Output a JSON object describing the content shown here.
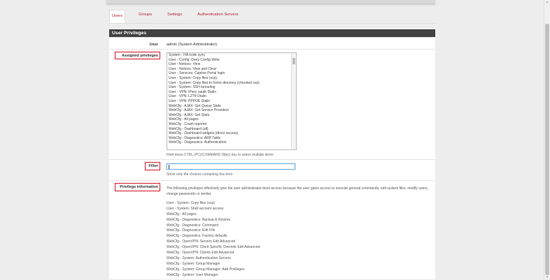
{
  "tabs": [
    {
      "label": "Users",
      "active": true
    },
    {
      "label": "Groups",
      "active": false
    },
    {
      "label": "Settings",
      "active": false
    },
    {
      "label": "Authentication Servers",
      "active": false
    }
  ],
  "panel_title": "User Privileges",
  "user": {
    "label": "User",
    "value": "admin (System Administrator)"
  },
  "assigned": {
    "label": "Assigned privileges",
    "options": [
      "System - HA node sync",
      "User - Config: Deny Config Write",
      "User - Notices: View",
      "User - Notices: View and Clear",
      "User - Services: Captive Portal login",
      "User - System: Copy files (scp).",
      "User - System: Copy files to home directory (chrooted scp)",
      "User - System: SSH tunneling",
      "User - VPN: IPsec xauth Dialin",
      "User - VPN: L2TP Dialin",
      "User - VPN: PPPOE Dialin",
      "WebCfg - AJAX: Get Queue Stats",
      "WebCfg - AJAX: Get Service Providers",
      "WebCfg - AJAX: Get Stats",
      "WebCfg - All pages",
      "WebCfg - Crash reporter",
      "WebCfg - Dashboard (all)",
      "WebCfg - Dashboard widgets (direct access).",
      "WebCfg - Diagnostics: ARP Table",
      "WebCfg - Diagnostics: Authentication"
    ],
    "help": "Hold down CTRL (PC)/COMMAND (Mac) key to select multiple items."
  },
  "filter": {
    "label": "Filter",
    "value": "",
    "help": "Show only the choices containing this term"
  },
  "privilege_info": {
    "label": "Privilege information",
    "text": "The following privileges effectively give the user administrator-level access because the user gains access to execute general commands, edit system files, modify users, change passwords or similar.",
    "items": [
      "User - System: Copy files (scp)",
      "User - System: Shell account access",
      "WebCfg - All pages",
      "WebCfg - Diagnostics: Backup & Restore",
      "WebCfg - Diagnostics: Command",
      "WebCfg - Diagnostics: Edit FIle",
      "WebCfg - Diagnostics: Factory defaults",
      "WebCfg - OpenVPN: Servers Edit Advanced",
      "WebCfg - OpenVPN: Client Specific Override Edit Advanced",
      "WebCfg - OpenVPN: Clients Edit Advanced",
      "WebCfg - System: Authentication Servers",
      "WebCfg - System: Group Manager",
      "WebCfg - System: Group Manager: Add Privileges",
      "WebCfg - System: User Manager"
    ]
  }
}
